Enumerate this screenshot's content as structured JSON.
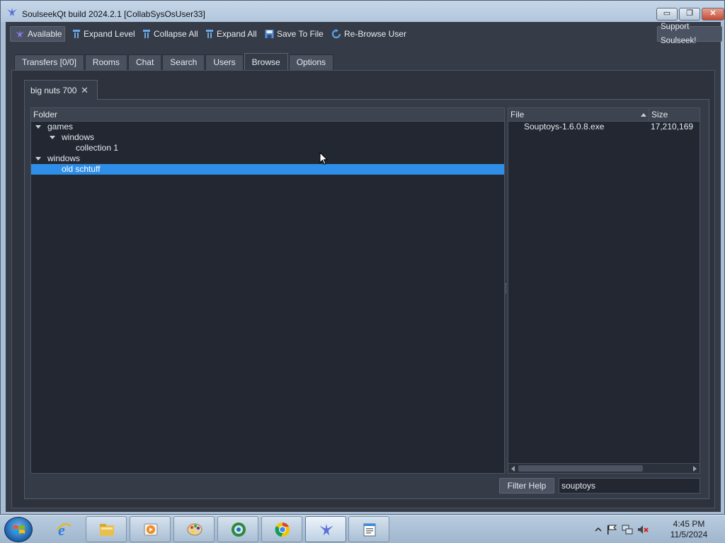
{
  "window": {
    "title": "SoulseekQt build 2024.2.1 [CollabSysOsUser33]",
    "min_glyph": "▭",
    "max_glyph": "❐",
    "close_glyph": "✕"
  },
  "toolbar": {
    "available": "Available",
    "expand_level": "Expand Level",
    "collapse_all": "Collapse All",
    "expand_all": "Expand All",
    "save_to_file": "Save To File",
    "re_browse_user": "Re-Browse User",
    "support": "Support Soulseek!"
  },
  "tabs": [
    {
      "label": "Transfers [0/0]"
    },
    {
      "label": "Rooms"
    },
    {
      "label": "Chat"
    },
    {
      "label": "Search"
    },
    {
      "label": "Users"
    },
    {
      "label": "Browse",
      "active": true
    },
    {
      "label": "Options"
    }
  ],
  "browse": {
    "user_tab": "big nuts 700",
    "user_tab_close": "✕",
    "folder_header": "Folder",
    "folders": [
      {
        "label": "games",
        "expanded": true
      },
      {
        "label": "windows",
        "expanded": true
      },
      {
        "label": "collection 1"
      },
      {
        "label": "windows",
        "expanded": true
      },
      {
        "label": "old schtuff",
        "selected": true
      }
    ],
    "file_header": "File",
    "size_header": "Size",
    "files": [
      {
        "name": "Souptoys-1.6.0.8.exe",
        "size": "17,210,169"
      }
    ],
    "filter_button": "Filter Help",
    "filter_value": "souptoys"
  },
  "taskbar": {
    "time": "4:45 PM",
    "date": "11/5/2024",
    "apps": [
      "internet-explorer",
      "file-explorer",
      "media-player",
      "paint",
      "media-center",
      "chrome",
      "soulseek",
      "notepad"
    ]
  },
  "colors": {
    "selection": "#2f8fe8",
    "background": "#363c47",
    "tree_bg": "#222731"
  }
}
